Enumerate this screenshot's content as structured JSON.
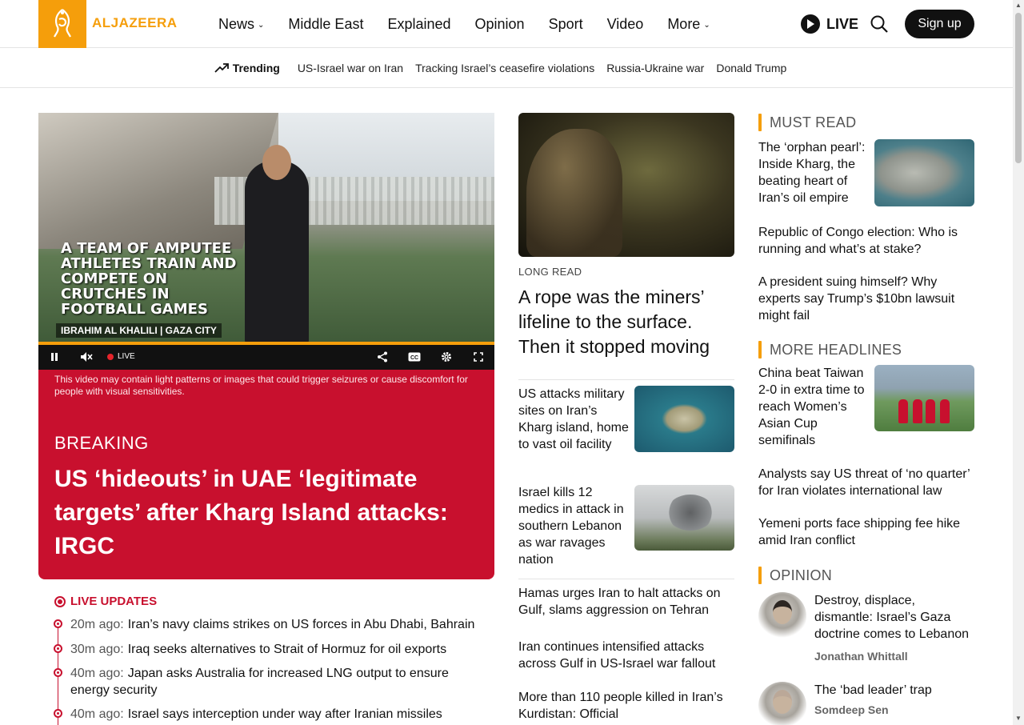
{
  "header": {
    "logo_text": "ALJAZEERA",
    "nav": [
      {
        "label": "News",
        "has_dropdown": true
      },
      {
        "label": "Middle East",
        "has_dropdown": false
      },
      {
        "label": "Explained",
        "has_dropdown": false
      },
      {
        "label": "Opinion",
        "has_dropdown": false
      },
      {
        "label": "Sport",
        "has_dropdown": false
      },
      {
        "label": "Video",
        "has_dropdown": false
      },
      {
        "label": "More",
        "has_dropdown": true
      }
    ],
    "live_label": "LIVE",
    "signup_label": "Sign up",
    "icons": {
      "play": "play-icon",
      "search": "search-icon",
      "chevron": "chevron-down-icon"
    }
  },
  "trending": {
    "label": "Trending",
    "links": [
      "US-Israel war on Iran",
      "Tracking Israel’s ceasefire violations",
      "Russia-Ukraine war",
      "Donald Trump"
    ]
  },
  "video": {
    "caption": "A TEAM OF AMPUTEE ATHLETES TRAIN AND COMPETE ON CRUTCHES IN FOOTBALL GAMES",
    "credit": "IBRAHIM AL KHALILI  |  GAZA CITY",
    "live_label": "LIVE",
    "warning": "This video may contain light patterns or images that could trigger seizures or cause discomfort for people with visual sensitivities."
  },
  "breaking": {
    "tag": "BREAKING",
    "headline": "US ‘hideouts’ in UAE ‘legitimate targets’ after Kharg Island attacks: IRGC"
  },
  "live_updates": {
    "title": "LIVE UPDATES",
    "items": [
      {
        "time": "20m ago:",
        "text": "Iran’s navy claims strikes on US forces in Abu Dhabi, Bahrain"
      },
      {
        "time": "30m ago:",
        "text": "Iraq seeks alternatives to Strait of Hormuz for oil exports"
      },
      {
        "time": "40m ago:",
        "text": "Japan asks Australia for increased LNG output to ensure energy security"
      },
      {
        "time": "40m ago:",
        "text": "Israel says interception under way after Iranian missiles"
      }
    ]
  },
  "long_read": {
    "kicker": "LONG READ",
    "title": "A rope was the miners’ lifeline to the surface. Then it stopped moving"
  },
  "middle_stories": [
    {
      "text": "US attacks military sites on Iran’s Kharg island, home to vast oil facility",
      "has_image": true
    },
    {
      "text": "Israel kills 12 medics in attack in southern Lebanon as war ravages nation",
      "has_image": true
    },
    {
      "text": "Hamas urges Iran to halt attacks on Gulf, slams aggression on Tehran",
      "has_image": false
    },
    {
      "text": "Iran continues intensified attacks across Gulf in US-Israel war fallout",
      "has_image": false
    },
    {
      "text": "More than 110 people killed in Iran’s Kurdistan: Official",
      "has_image": false
    }
  ],
  "must_read": {
    "title": "MUST READ",
    "stories": [
      {
        "text": "The ‘orphan pearl’: Inside Kharg, the beating heart of Iran’s oil empire",
        "has_image": true
      },
      {
        "text": "Republic of Congo election: Who is running and what’s at stake?",
        "has_image": false
      },
      {
        "text": "A president suing himself? Why experts say Trump’s $10bn lawsuit might fail",
        "has_image": false
      }
    ]
  },
  "more_headlines": {
    "title": "MORE HEADLINES",
    "stories": [
      {
        "text": "China beat Taiwan 2-0 in extra time to reach Women’s Asian Cup semifinals",
        "has_image": true
      },
      {
        "text": "Analysts say US threat of ‘no quarter’ for Iran violates international law",
        "has_image": false
      },
      {
        "text": "Yemeni ports face shipping fee hike amid Iran conflict",
        "has_image": false
      }
    ]
  },
  "opinion": {
    "title": "OPINION",
    "items": [
      {
        "text": "Destroy, displace, dismantle: Israel’s Gaza doctrine comes to Lebanon",
        "author": "Jonathan Whittall"
      },
      {
        "text": "The ‘bad leader’ trap",
        "author": "Somdeep Sen"
      }
    ]
  },
  "colors": {
    "brand": "#f59e0b",
    "breaking": "#c8102e",
    "text": "#111111"
  }
}
